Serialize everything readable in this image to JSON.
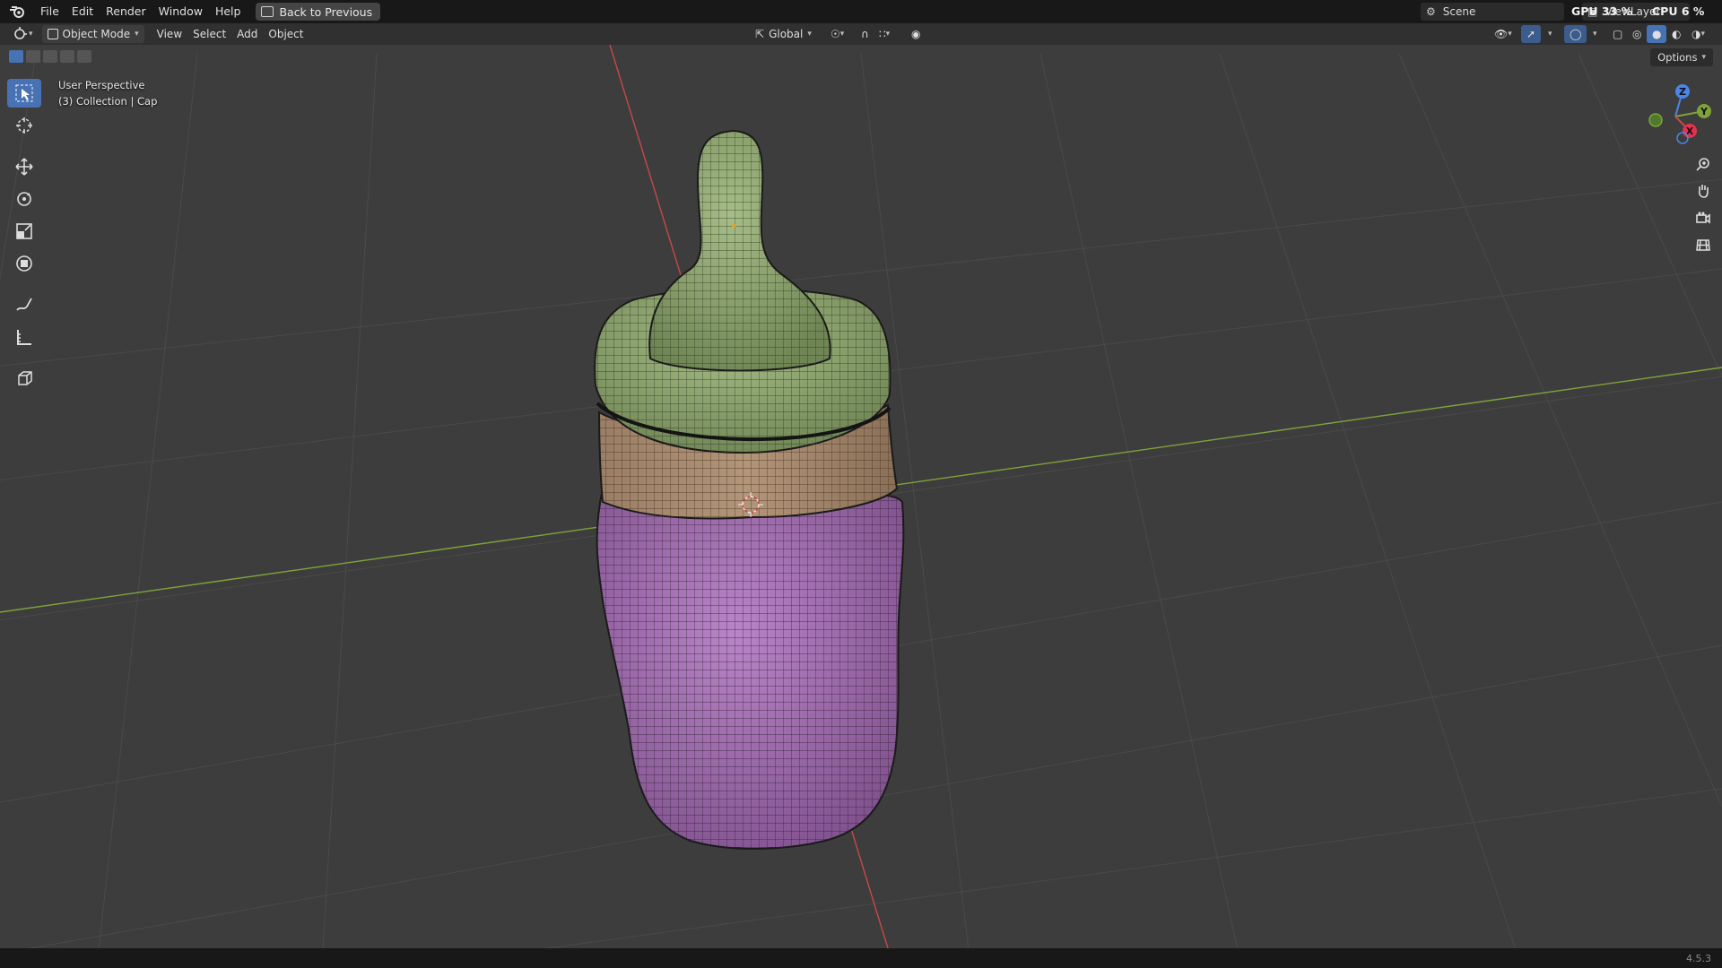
{
  "menu": {
    "items": [
      "File",
      "Edit",
      "Render",
      "Window",
      "Help"
    ],
    "back_label": "Back to Previous"
  },
  "scene": {
    "label": "Scene"
  },
  "view_layer": {
    "label": "ViewLayer"
  },
  "stats": {
    "gpu": "GPU 33 %",
    "cpu": "CPU 6 %"
  },
  "header": {
    "mode": "Object Mode",
    "items": [
      "View",
      "Select",
      "Add",
      "Object"
    ],
    "transform_orientation": "Global"
  },
  "viewport": {
    "info_line1": "User Perspective",
    "info_line2": "(3) Collection | Cap",
    "options_label": "Options",
    "gizmo": {
      "z": "Z",
      "y": "Y",
      "x": "X"
    }
  },
  "status": {
    "version": "4.5.3"
  },
  "colors": {
    "background": "#3d3d3d",
    "topbar": "#181818",
    "header": "#303030",
    "accent": "#4772b3",
    "x_axis": "#c8484a",
    "y_axis": "#7fa33a",
    "z_axis": "#4a86e8",
    "cap_green": "#9ab07a",
    "ring_brown": "#ac8d72",
    "bottle_purple": "#a873b6"
  },
  "icons": [
    "blender-logo-icon",
    "back-to-previous-icon",
    "scene-icon",
    "view-layer-icon",
    "select-box-icon",
    "cursor-icon",
    "move-icon",
    "rotate-icon",
    "scale-icon",
    "transform-icon",
    "annotate-icon",
    "measure-icon",
    "add-cube-icon",
    "zoom-icon",
    "pan-hand-icon",
    "camera-icon",
    "grid-view-icon"
  ]
}
